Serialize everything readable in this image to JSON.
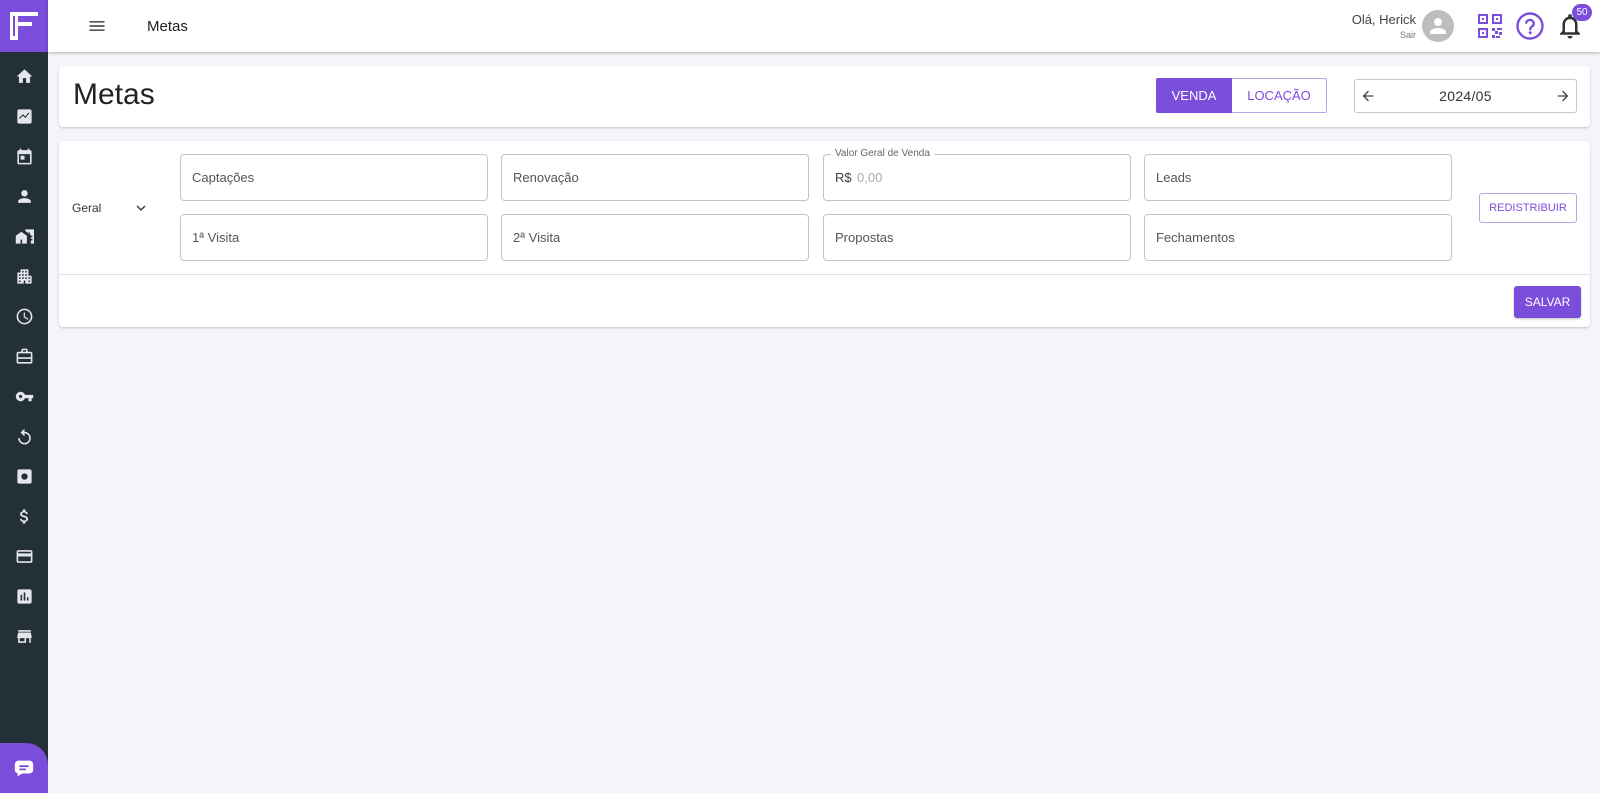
{
  "sidebar": {
    "items": [
      {
        "icon": "home-icon"
      },
      {
        "icon": "trending-up-icon"
      },
      {
        "icon": "calendar-icon"
      },
      {
        "icon": "person-icon"
      },
      {
        "icon": "houses-icon"
      },
      {
        "icon": "building-icon"
      },
      {
        "icon": "clock-icon"
      },
      {
        "icon": "briefcase-icon"
      },
      {
        "icon": "key-icon"
      },
      {
        "icon": "refresh-icon"
      },
      {
        "icon": "settings-box-icon"
      },
      {
        "icon": "dollar-icon"
      },
      {
        "icon": "credit-card-icon"
      },
      {
        "icon": "bar-chart-icon"
      },
      {
        "icon": "store-icon"
      }
    ]
  },
  "topbar": {
    "title": "Metas",
    "greeting": "Olá, Herick",
    "logout": "Sair",
    "notification_count": "50"
  },
  "header": {
    "title": "Metas",
    "toggle_sale": "VENDA",
    "toggle_rent": "LOCAÇÃO",
    "month": "2024/05"
  },
  "goals": {
    "scope": "Geral",
    "fields": {
      "captacoes": "Captações",
      "renovacao": "Renovação",
      "valor_legend": "Valor Geral de Venda",
      "valor_prefix": "R$",
      "valor_placeholder": "0,00",
      "leads": "Leads",
      "visita1": "1ª Visita",
      "visita2": "2ª Visita",
      "propostas": "Propostas",
      "fechamentos": "Fechamentos"
    },
    "redistribute_label": "REDISTRIBUIR",
    "save_label": "SALVAR"
  },
  "colors": {
    "accent": "#7b4ddb",
    "sidebar": "#243038",
    "background": "#f4f4fa"
  }
}
